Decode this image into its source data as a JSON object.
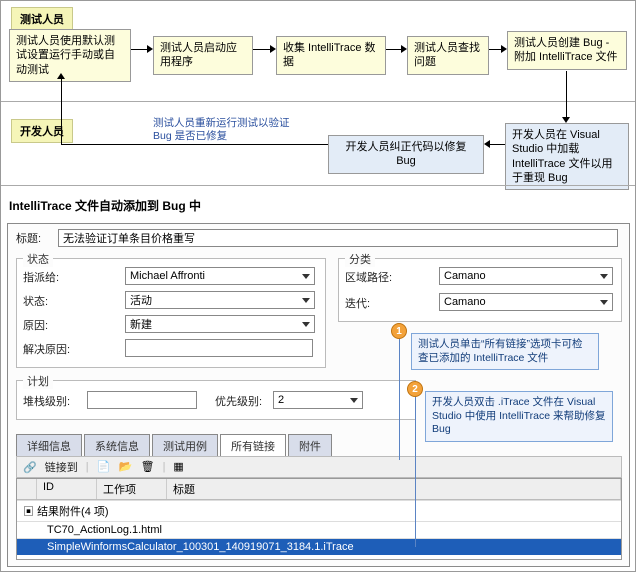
{
  "roles": {
    "tester": "测试人员",
    "developer": "开发人员"
  },
  "flow": {
    "t1": "测试人员使用默认测试设置运行手动或自动测试",
    "t2": "测试人员启动应用程序",
    "t3": "收集 IntelliTrace 数据",
    "t4": "测试人员查找问题",
    "t5": "测试人员创建 Bug - 附加 IntelliTrace 文件",
    "d1": "开发人员在 Visual Studio 中加载 IntelliTrace 文件以用于重现 Bug",
    "d2": "开发人员纠正代码以修复 Bug",
    "note": "测试人员重新运行测试以验证 Bug 是否已修复"
  },
  "section_title": "IntelliTrace 文件自动添加到 Bug 中",
  "form": {
    "title_label": "标题:",
    "title_value": "无法验证订单条目价格重写",
    "state_group": "状态",
    "assigned_label": "指派给:",
    "assigned_value": "Michael Affronti",
    "status_label": "状态:",
    "status_value": "活动",
    "reason_label": "原因:",
    "reason_value": "新建",
    "resolve_reason_label": "解决原因:",
    "class_group": "分类",
    "area_label": "区域路径:",
    "area_value": "Camano",
    "iter_label": "迭代:",
    "iter_value": "Camano",
    "plan_group": "计划",
    "stack_label": "堆栈级别:",
    "priority_label": "优先级别:",
    "priority_value": "2",
    "tabs": [
      "详细信息",
      "系统信息",
      "测试用例",
      "所有链接",
      "附件"
    ],
    "linkto": "链接到",
    "cols": [
      "ID",
      "工作项",
      "标题"
    ],
    "attach_header": "结果附件(4 项)",
    "files": [
      "TC70_ActionLog.1.html",
      "SimpleWinformsCalculator_100301_140919071_3184.1.iTrace"
    ]
  },
  "callouts": {
    "c1": "测试人员单击“所有链接”选项卡可检查已添加的 IntelliTrace 文件",
    "c2": "开发人员双击 .iTrace 文件在 Visual Studio 中使用 IntelliTrace 来帮助修复 Bug"
  }
}
